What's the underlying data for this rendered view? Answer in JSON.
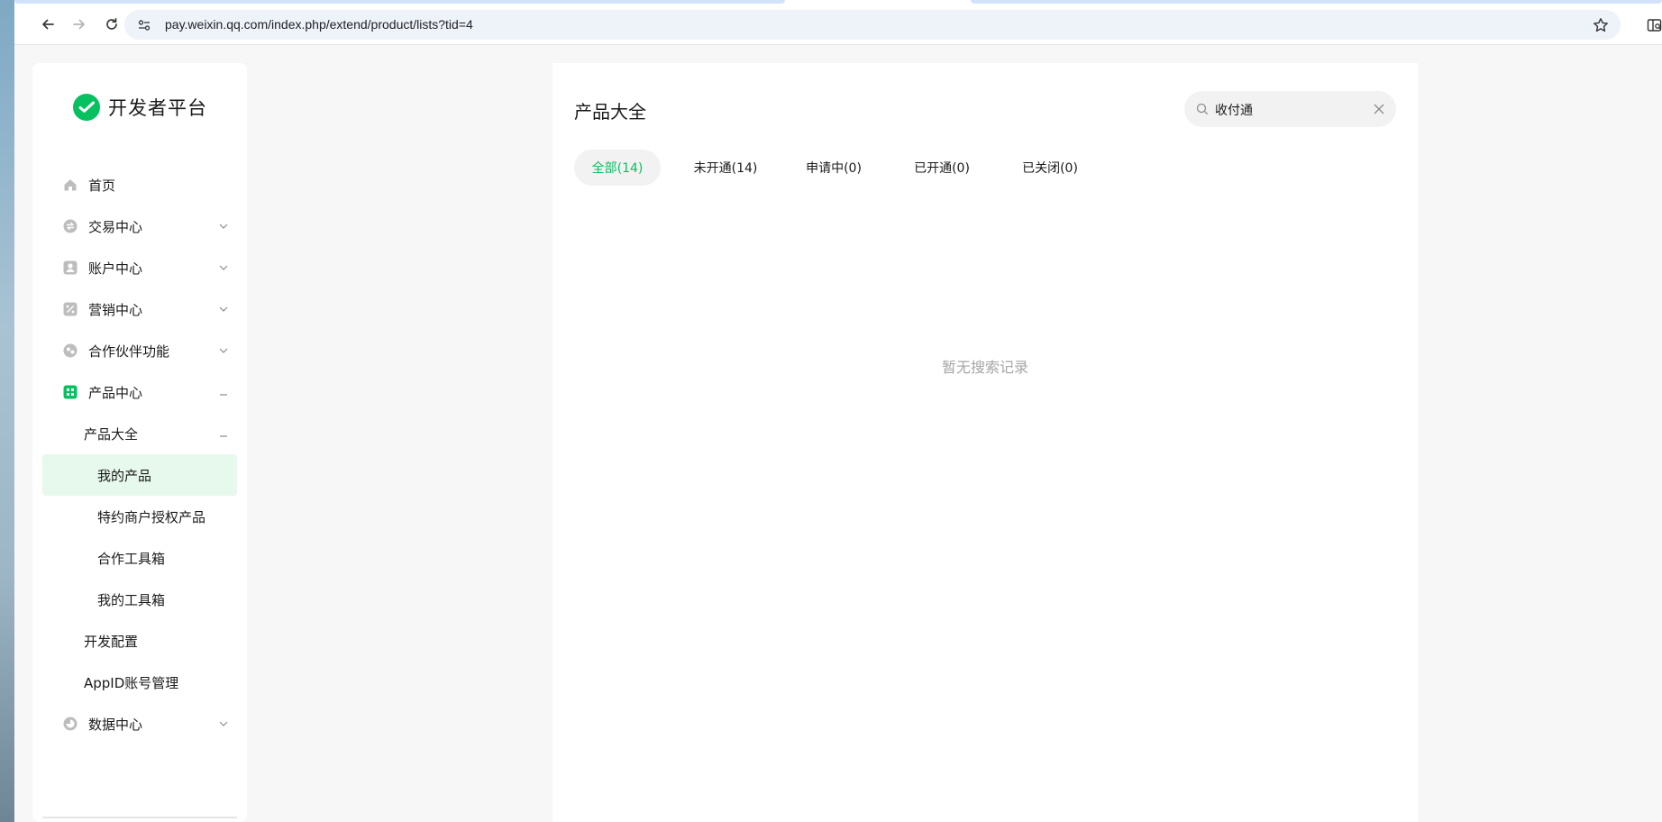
{
  "browser": {
    "url": "pay.weixin.qq.com/index.php/extend/product/lists?tid=4"
  },
  "brand": {
    "name": "开发者平台"
  },
  "sidebar": {
    "items": [
      {
        "label": "首页",
        "icon": "home-icon"
      },
      {
        "label": "交易中心",
        "icon": "exchange-icon"
      },
      {
        "label": "账户中心",
        "icon": "account-icon"
      },
      {
        "label": "营销中心",
        "icon": "coupon-icon"
      },
      {
        "label": "合作伙伴功能",
        "icon": "partner-icon"
      },
      {
        "label": "产品中心",
        "icon": "grid-icon"
      },
      {
        "label": "产品大全"
      },
      {
        "label": "我的产品"
      },
      {
        "label": "特约商户授权产品"
      },
      {
        "label": "合作工具箱"
      },
      {
        "label": "我的工具箱"
      },
      {
        "label": "开发配置"
      },
      {
        "label": "AppID账号管理"
      },
      {
        "label": "数据中心",
        "icon": "chart-pie-icon"
      }
    ]
  },
  "main": {
    "title": "产品大全",
    "search": {
      "value": "收付通"
    },
    "tabs": [
      {
        "label": "全部(14)"
      },
      {
        "label": "未开通(14)"
      },
      {
        "label": "申请中(0)"
      },
      {
        "label": "已开通(0)"
      },
      {
        "label": "已关闭(0)"
      }
    ],
    "empty_text": "暂无搜索记录"
  },
  "colors": {
    "accent": "#07c160",
    "active_bg": "#e7f8ec",
    "page_bg": "#f7f7f7"
  }
}
